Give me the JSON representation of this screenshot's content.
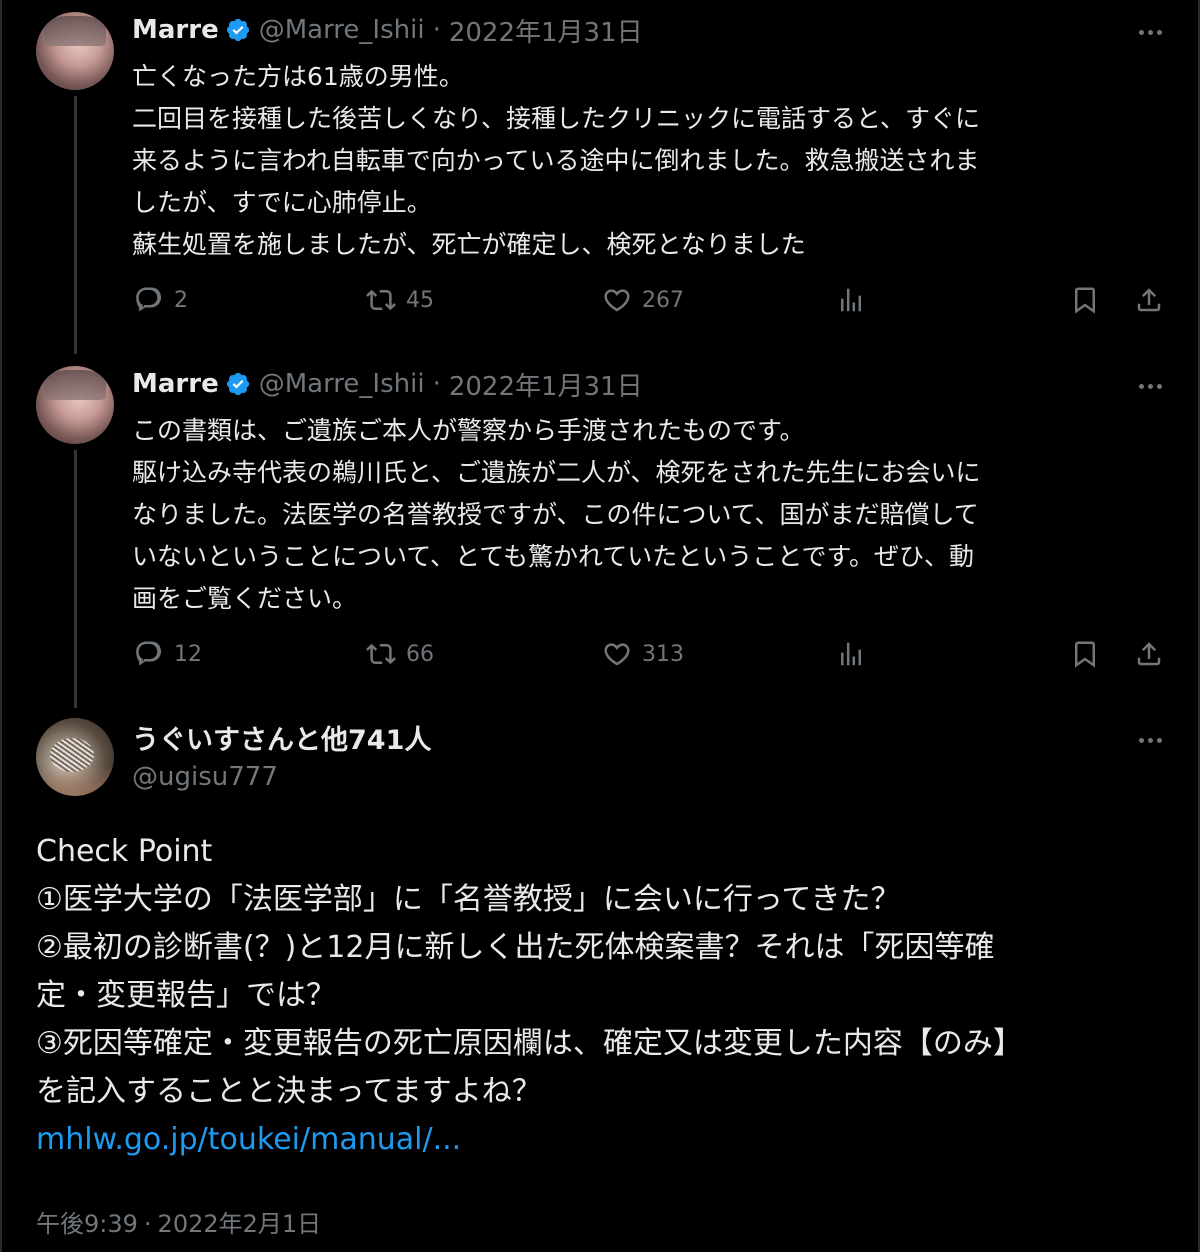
{
  "tweets": [
    {
      "name": "Marre",
      "handle": "@Marre_Ishii",
      "date": "2022年1月31日",
      "lines": [
        "亡くなった方は61歳の男性。",
        "二回目を接種した後苦しくなり、接種したクリニックに電話すると、すぐに",
        "来るように言われ自転車で向かっている途中に倒れました。救急搬送されま",
        "したが、すでに心肺停止。",
        "蘇生処置を施しましたが、死亡が確定し、検死となりました"
      ],
      "replies": "2",
      "retweets": "45",
      "likes": "267"
    },
    {
      "name": "Marre",
      "handle": "@Marre_Ishii",
      "date": "2022年1月31日",
      "lines": [
        "この書類は、ご遺族ご本人が警察から手渡されたものです。",
        "駆け込み寺代表の鵜川氏と、ご遺族が二人が、検死をされた先生にお会いに",
        "なりました。法医学の名誉教授ですが、この件について、国がまだ賠償して",
        "いないということについて、とても驚かれていたということです。ぜひ、動",
        "画をご覧ください。"
      ],
      "replies": "12",
      "retweets": "66",
      "likes": "313"
    }
  ],
  "main": {
    "name": "うぐいすさんと他741人",
    "handle": "@ugisu777",
    "lines": [
      "Check Point",
      "①医学大学の「法医学部」に「名誉教授」に会いに行ってきた？",
      "②最初の診断書(？)と12月に新しく出た死体検案書？それは「死因等確",
      "定・変更報告」では？",
      "③死因等確定・変更報告の死亡原因欄は、確定又は変更した内容【のみ】",
      "を記入することと決まってますよね？"
    ],
    "link": "mhlw.go.jp/toukei/manual/...",
    "time": "午後9:39",
    "date": "2022年2月1日",
    "separator": "·"
  },
  "icons": {
    "verified": "verified-badge-icon",
    "more": "more-icon",
    "reply": "reply-icon",
    "retweet": "retweet-icon",
    "like": "like-icon",
    "views": "views-icon",
    "bookmark": "bookmark-icon",
    "share": "share-icon"
  },
  "colors": {
    "background": "#000000",
    "text": "#e7e9ea",
    "muted": "#71767b",
    "link": "#1d9bf0",
    "verified": "#1d9bf0",
    "thread_line": "#333639"
  }
}
